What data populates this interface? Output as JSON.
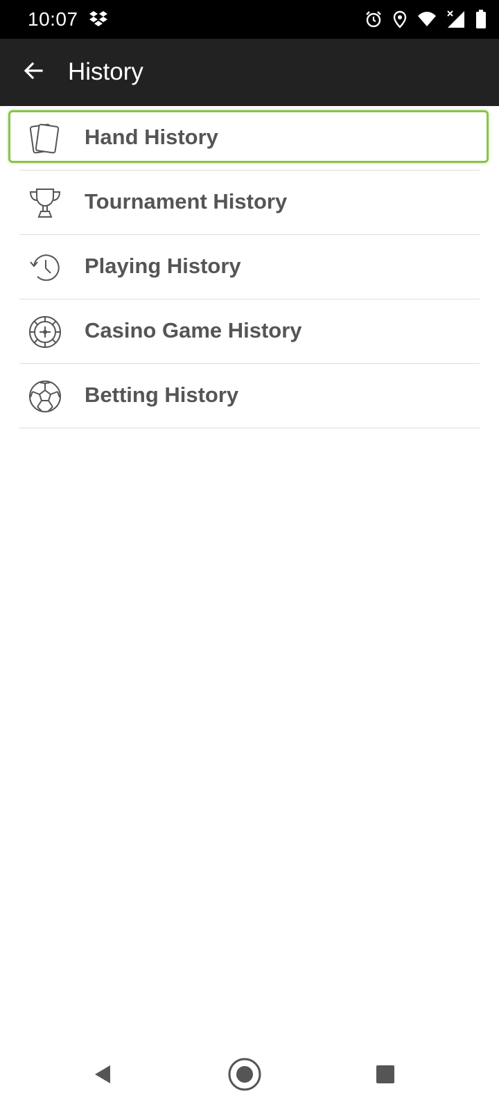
{
  "status_bar": {
    "time": "10:07",
    "icons": [
      "dropbox-icon",
      "alarm-icon",
      "location-icon",
      "wifi-icon",
      "signal-icon",
      "battery-icon"
    ]
  },
  "app_bar": {
    "title": "History",
    "back_icon": "arrow-back-icon"
  },
  "list": {
    "items": [
      {
        "label": "Hand History",
        "icon": "cards-icon",
        "selected": true
      },
      {
        "label": "Tournament History",
        "icon": "trophy-icon",
        "selected": false
      },
      {
        "label": "Playing History",
        "icon": "history-clock-icon",
        "selected": false
      },
      {
        "label": "Casino Game History",
        "icon": "roulette-icon",
        "selected": false
      },
      {
        "label": "Betting History",
        "icon": "soccer-ball-icon",
        "selected": false
      }
    ]
  },
  "nav_bar": {
    "buttons": [
      "back-triangle-icon",
      "home-circle-icon",
      "recents-square-icon"
    ]
  },
  "colors": {
    "status_bar_bg": "#000000",
    "app_bar_bg": "#222222",
    "highlight": "#8bc34a",
    "label_text": "#555555",
    "divider": "#dcdcdc"
  }
}
